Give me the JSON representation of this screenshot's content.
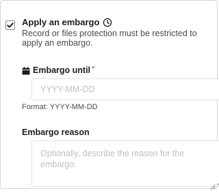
{
  "embargo_option": {
    "checked": true,
    "title": "Apply an embargo",
    "info_icon": "clock-icon",
    "description": "Record or files protection must be restricted to apply an embargo."
  },
  "embargo_until": {
    "icon": "calendar-icon",
    "label": "Embargo until",
    "required_mark": "*",
    "placeholder": "YYYY-MM-DD",
    "value": "",
    "help_text": "Format: YYYY-MM-DD"
  },
  "embargo_reason": {
    "label": "Embargo reason",
    "placeholder": "Optionally, describe the reason for the embargo.",
    "value": ""
  },
  "colors": {
    "required": "#db2828",
    "placeholder": "#bfbfbf",
    "border": "#e2e2e2"
  }
}
